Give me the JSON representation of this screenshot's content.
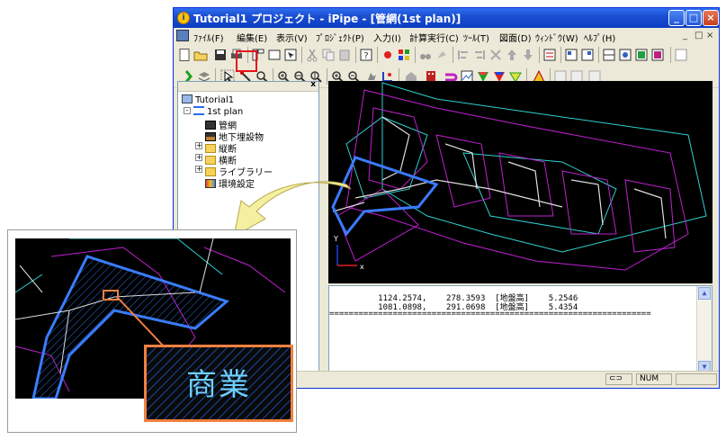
{
  "window": {
    "title": "Tutorial1 プロジェクト - iPipe - [管網(1st plan)]",
    "title_icon": "info-icon",
    "min_glyph": "_",
    "max_glyph": "□",
    "close_glyph": "×"
  },
  "menubar": {
    "items": [
      "ﾌｧｲﾙ(F)",
      "編集(E)",
      "表示(V)",
      "ﾌﾟﾛｼﾞｪｸﾄ(P)",
      "入力(I)",
      "計算実行(C)",
      "ﾂｰﾙ(T)",
      "図面(D)",
      "ｳｨﾝﾄﾞｳ(W)",
      "ﾍﾙﾌﾟ(H)"
    ],
    "mdi_controls": [
      "_",
      "□",
      "×"
    ]
  },
  "tree": {
    "close_glyph": "x",
    "nodes": [
      {
        "label": "Tutorial1",
        "icon": "project-icon"
      },
      {
        "label": "1st plan",
        "icon": "plan-icon"
      },
      {
        "label": "管網",
        "icon": "network-icon"
      },
      {
        "label": "地下埋設物",
        "icon": "buried-object-icon"
      },
      {
        "label": "縦断",
        "icon": "folder-icon"
      },
      {
        "label": "横断",
        "icon": "folder-icon"
      },
      {
        "label": "ライブラリー",
        "icon": "folder-icon"
      },
      {
        "label": "環境設定",
        "icon": "settings-icon"
      }
    ],
    "expand_glyph": "+",
    "collapse_glyph": "-"
  },
  "view": {
    "axis_y": "Y",
    "axis_x": "x"
  },
  "console": {
    "lines": [
      "          1124.2574,    278.3593  [地盤高]    5.2546",
      "          1081.0898,    291.0698  [地盤高]    5.4354",
      "=================================================================="
    ]
  },
  "statusbar": {
    "num": "NUM",
    "link_icon": "link-icon"
  },
  "callout": {
    "label": "商業"
  },
  "colors": {
    "selection_highlight": "#e8101c",
    "callout_border": "#f08040",
    "pipe_blue": "#3a7cff",
    "outline_magenta": "#c020d0",
    "outline_cyan": "#30d0d0"
  }
}
